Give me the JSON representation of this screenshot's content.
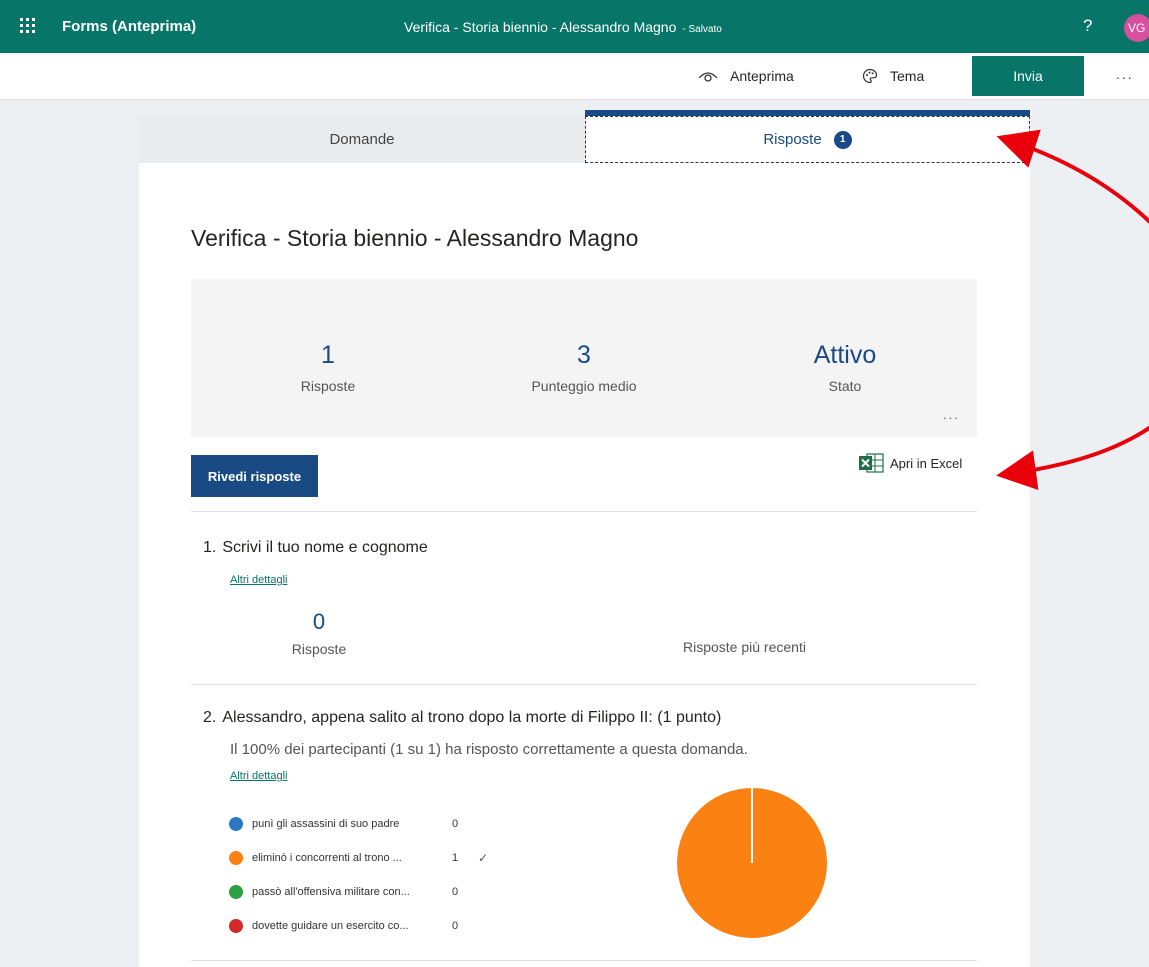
{
  "appbar": {
    "app_name": "Forms (Anteprima)",
    "doc_title": "Verifica - Storia biennio - Alessandro Magno",
    "doc_status": "- Salvato",
    "help": "?",
    "avatar_initials": "VG"
  },
  "toolbar": {
    "preview_label": "Anteprima",
    "theme_label": "Tema",
    "send_label": "Invia",
    "more_label": "..."
  },
  "tabs": [
    {
      "label": "Domande"
    },
    {
      "label": "Risposte",
      "badge": "1"
    }
  ],
  "form": {
    "title": "Verifica - Storia biennio - Alessandro Magno"
  },
  "summary": {
    "stats": [
      {
        "value": "1",
        "label": "Risposte"
      },
      {
        "value": "3",
        "label": "Punteggio medio"
      },
      {
        "value": "Attivo",
        "label": "Stato"
      }
    ],
    "more_label": "..."
  },
  "actions": {
    "review_label": "Rivedi risposte",
    "excel_label": "Apri in Excel"
  },
  "questions": [
    {
      "number": "1.",
      "title": "Scrivi il tuo nome e cognome",
      "details_link": "Altri dettagli",
      "count_value": "0",
      "count_label": "Risposte",
      "recent_label": "Risposte più recenti"
    },
    {
      "number": "2.",
      "title": "Alessandro, appena salito al trono dopo la morte di Filippo II: (1 punto)",
      "note": "Il 100% dei partecipanti (1 su 1) ha risposto correttamente a questa domanda.",
      "details_link": "Altri dettagli",
      "options": [
        {
          "label": "punì gli assassini di suo padre",
          "count": "0",
          "color": "#2a78c3",
          "correct": false
        },
        {
          "label": "eliminò i concorrenti al trono ...",
          "count": "1",
          "color": "#fb8113",
          "correct": true
        },
        {
          "label": "passò all'offensiva militare con...",
          "count": "0",
          "color": "#2ea043",
          "correct": false
        },
        {
          "label": "dovette guidare un esercito co...",
          "count": "0",
          "color": "#d22a2a",
          "correct": false
        }
      ]
    }
  ],
  "colors": {
    "brand": "#077568",
    "accent": "#1a4a83",
    "annotation": "#e8000b"
  },
  "icons": {
    "preview": "eye-icon",
    "theme": "palette-icon",
    "excel": "excel-icon",
    "check": "checkmark-icon"
  }
}
